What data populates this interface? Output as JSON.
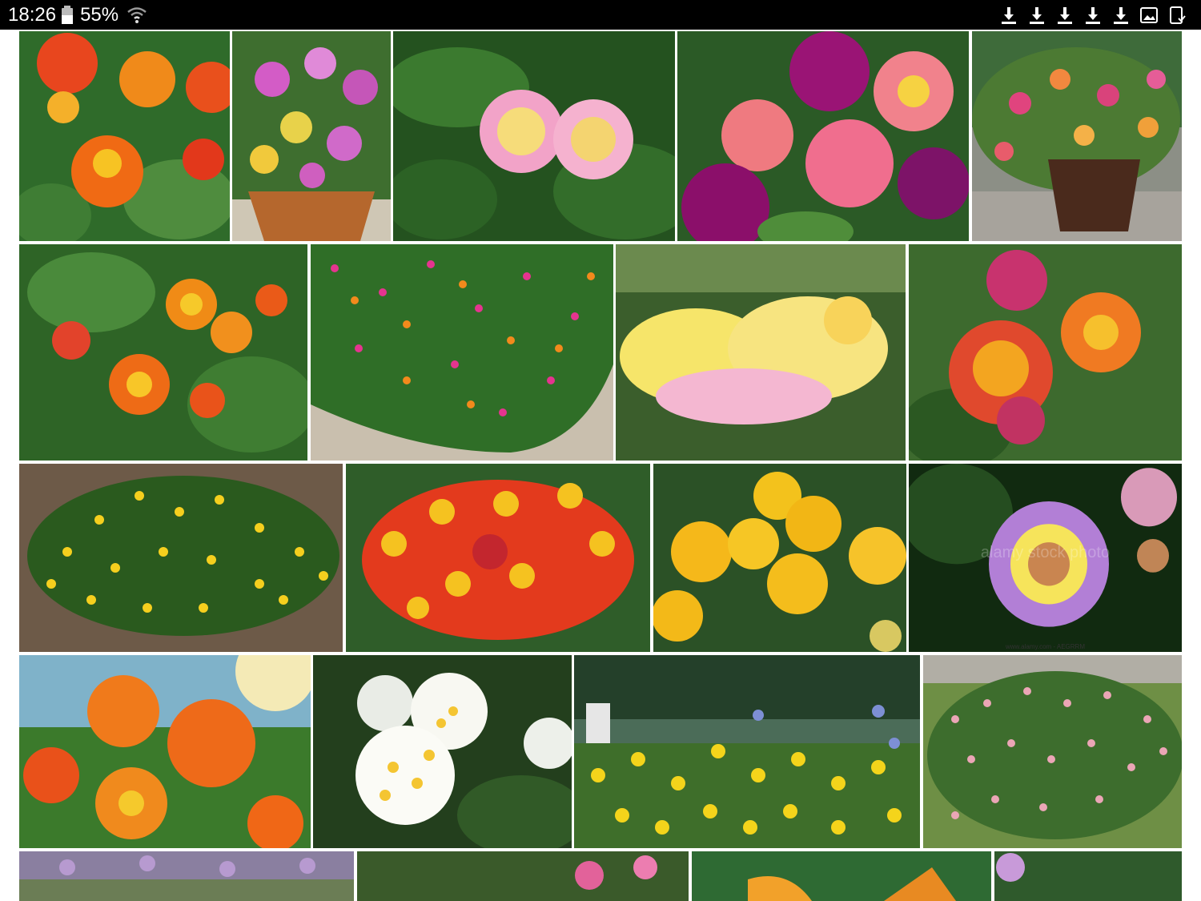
{
  "status_bar": {
    "time": "18:26",
    "battery_percent": "55%",
    "icons": [
      "battery-icon",
      "wifi-icon",
      "download-icon",
      "download-icon",
      "download-icon",
      "download-icon",
      "download-icon",
      "image-icon",
      "screenshot-icon"
    ]
  },
  "gallery": {
    "background": "#ffffff",
    "images": [
      {
        "name": "image-tile-orange-lantana",
        "subject": "orange red lantana clusters"
      },
      {
        "name": "image-tile-basket-lantana",
        "subject": "pink yellow lantana in wicker basket"
      },
      {
        "name": "image-tile-pink-cream-lantana",
        "subject": "pink and cream lantana blooms"
      },
      {
        "name": "image-tile-magenta-lantana",
        "subject": "magenta and coral lantana"
      },
      {
        "name": "image-tile-potted-lantana",
        "subject": "lantana in brown pot"
      },
      {
        "name": "image-tile-orange-yellow-shrub",
        "subject": "orange yellow lantana with leaves"
      },
      {
        "name": "image-tile-hedge-lantana",
        "subject": "multicolor lantana hedge"
      },
      {
        "name": "image-tile-yellow-pink-lantana",
        "subject": "yellow and pink lantana"
      },
      {
        "name": "image-tile-red-orange-lantana",
        "subject": "red orange lantana closeup"
      },
      {
        "name": "image-tile-yellow-groundcover",
        "subject": "yellow lantana groundcover on mulch"
      },
      {
        "name": "image-tile-red-yellow-cluster",
        "subject": "red and yellow lantana cluster"
      },
      {
        "name": "image-tile-gold-lantana",
        "subject": "golden yellow lantana"
      },
      {
        "name": "image-tile-purple-lantana",
        "subject": "purple and yellow lantana"
      },
      {
        "name": "image-tile-sunlit-orange",
        "subject": "orange lantana in sunlight"
      },
      {
        "name": "image-tile-white-lantana",
        "subject": "white lantana with yellow centers"
      },
      {
        "name": "image-tile-garden-bed",
        "subject": "yellow lantana garden bed"
      },
      {
        "name": "image-tile-pink-shrub",
        "subject": "pink lantana shrub by stone wall"
      },
      {
        "name": "image-tile-partial-lavender",
        "subject": "lavender field"
      },
      {
        "name": "image-tile-partial-pink",
        "subject": "pink flowers"
      },
      {
        "name": "image-tile-partial-butterfly",
        "subject": "butterfly"
      },
      {
        "name": "image-tile-partial-flowers",
        "subject": "purple flowers"
      }
    ],
    "watermarks": {
      "alamy_bottom": "www.alamy.com - AEGRRM",
      "alamy_center": "alamy stock photo"
    }
  },
  "colors": {
    "status_bar": "#000000",
    "status_text": "#ffffff",
    "leaf_green": "#2f6b2a",
    "dark_green": "#1d3f1a"
  }
}
